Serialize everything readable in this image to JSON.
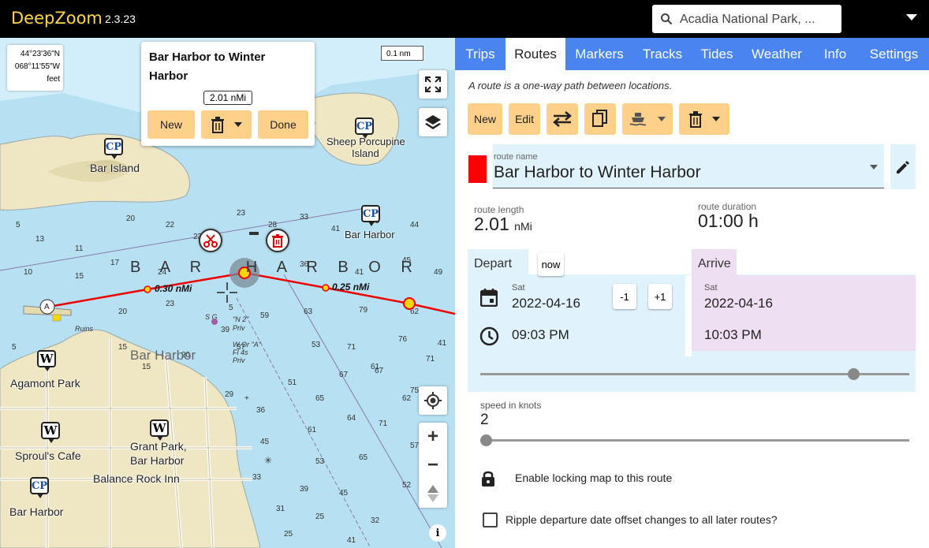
{
  "app": {
    "logo_deep": "Deep",
    "logo_zoom": "Zoom",
    "version": "2.3.23",
    "search_value": "Acadia National Park, ...",
    "accent_color": "#ffd64a",
    "tab_color": "#4a84f0",
    "button_color": "#ffd08a"
  },
  "map": {
    "lat": "44°23'36\"N",
    "lon": "068°11'55\"W",
    "depth_unit": "feet",
    "scale": "0.1 nm",
    "bay_label": "B A R   H A R B O R",
    "places": {
      "bar_island_cp": "CP",
      "bar_island": "Bar Island",
      "sheep_cp": "CP",
      "sheep_porcupine": "Sheep Porcupine",
      "island": "Island",
      "bar_harbor_cp": "CP",
      "bar_harbor_poi": "Bar Harbor",
      "bar_harbor_town": "Bar Harbor",
      "agamont_w": "W",
      "agamont": "Agamont Park",
      "sprouls_w": "W",
      "sprouls": "Sproul's Cafe",
      "grant_w": "W",
      "grant1": "Grant Park,",
      "grant2": "Bar Harbor",
      "balance": "Balance Rock Inn",
      "bh2_cp": "CP",
      "bh2": "Bar Harbor"
    },
    "start_marker": "A",
    "seg1": "0.30 nMi",
    "seg2": "0.25 nMi",
    "info": "i"
  },
  "popup": {
    "title": "Bar Harbor to Winter Harbor",
    "distance": "2.01  nMi",
    "new": "New",
    "done": "Done"
  },
  "tabs": [
    "Trips",
    "Routes",
    "Markers",
    "Tracks",
    "Tides",
    "Weather",
    "Info",
    "Settings"
  ],
  "routes": {
    "description": "A route is a one-way path between locations.",
    "btn_new": "New",
    "btn_edit": "Edit",
    "name_label": "route name",
    "name": "Bar Harbor to Winter Harbor",
    "route_color": "#ff0000",
    "length_label": "route length",
    "length_value": "2.01",
    "length_unit": "nMi",
    "duration_label": "route duration",
    "duration_value": "01:00 h",
    "depart_label": "Depart",
    "now": "now",
    "depart_day": "Sat",
    "depart_date": "2022-04-16",
    "depart_time": "09:03 PM",
    "minus": "-1",
    "plus": "+1",
    "arrive_label": "Arrive",
    "arrive_day": "Sat",
    "arrive_date": "2022-04-16",
    "arrive_time": "10:03 PM",
    "time_slider_fraction": 0.88,
    "speed_label": "speed in knots",
    "speed_value": "2",
    "speed_slider_fraction": 0.0,
    "lock_text": "Enable locking map to this route",
    "ripple_text": "Ripple departure date offset changes to all later routes?",
    "ripple_checked": false
  }
}
